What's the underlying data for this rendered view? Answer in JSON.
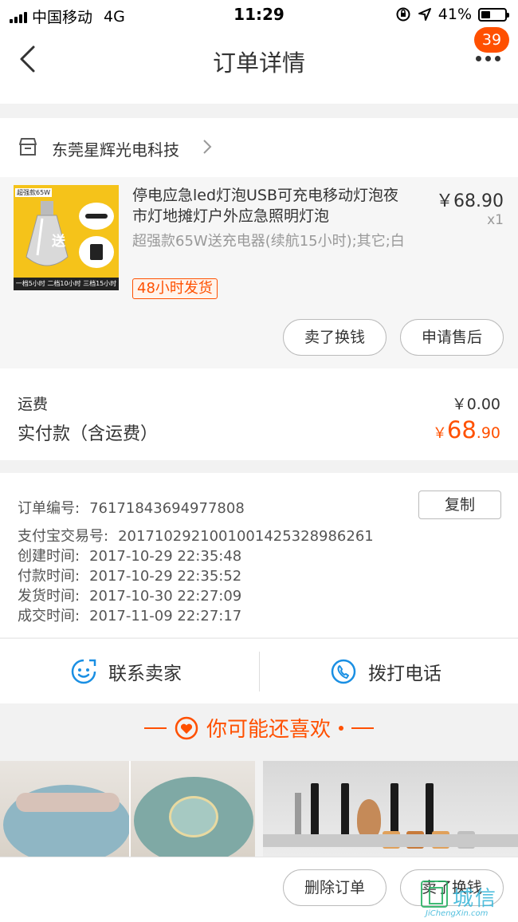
{
  "status_bar": {
    "carrier": "中国移动",
    "network": "4G",
    "time": "11:29",
    "battery_percent": "41%",
    "battery_level": 0.41
  },
  "nav": {
    "title": "订单详情",
    "badge_count": "39"
  },
  "shop": {
    "name": "东莞星辉光电科技"
  },
  "item": {
    "thumb_tag": "超强款65W",
    "thumb_gift": "送",
    "thumb_strip": "一档5小时 二档10小时 三档15小时",
    "title": "停电应急led灯泡USB可充电移动灯泡夜市灯地摊灯户外应急照明灯泡",
    "price": "￥68.90",
    "qty": "x1",
    "sku": "超强款65W送充电器(续航15小时);其它;白",
    "ship_tag": "48小时发货",
    "btn_sell": "卖了换钱",
    "btn_aftersale": "申请售后"
  },
  "fees": {
    "shipping_label": "运费",
    "shipping_value": "￥0.00",
    "paid_label": "实付款（含运费）",
    "paid_currency": "￥",
    "paid_int": "68",
    "paid_dec": ".90"
  },
  "info": {
    "order_no_label": "订单编号:",
    "order_no": "76171843694977808",
    "copy_label": "复制",
    "alipay_label": "支付宝交易号:",
    "alipay_no": "2017102921001001425328986261",
    "created_label": "创建时间:",
    "created": "2017-10-29 22:35:48",
    "paid_label": "付款时间:",
    "paid": "2017-10-29 22:35:52",
    "shipped_label": "发货时间:",
    "shipped": "2017-10-30 22:27:09",
    "closed_label": "成交时间:",
    "closed": "2017-11-09 22:27:17"
  },
  "contact": {
    "seller_label": "联系卖家",
    "phone_label": "拨打电话"
  },
  "recommend": {
    "title": "你可能还喜欢"
  },
  "bottom": {
    "delete_label": "删除订单",
    "sell_label": "卖了换钱"
  },
  "watermark": {
    "cn": "城信",
    "en": "JiChengXin.com"
  },
  "colors": {
    "accent": "#ff5000",
    "icon_blue": "#1a8fe3"
  }
}
